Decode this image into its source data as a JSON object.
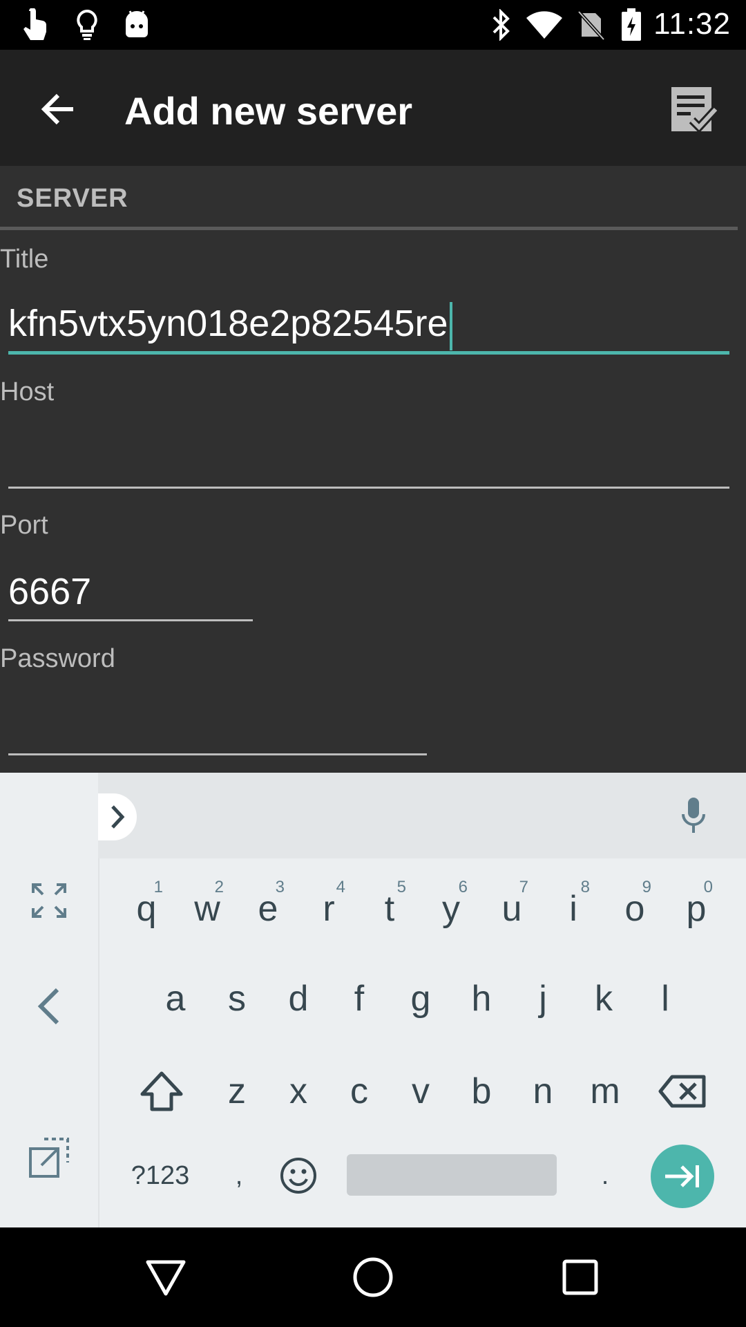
{
  "status_bar": {
    "time": "11:32",
    "left_icons": [
      "touch-hand-icon",
      "lightbulb-icon",
      "android-icon"
    ],
    "right_icons": [
      "bluetooth-icon",
      "wifi-icon",
      "no-sim-icon",
      "battery-charging-icon"
    ]
  },
  "app_bar": {
    "title": "Add new server",
    "back_icon": "arrow-back-icon",
    "save_icon": "checklist-icon"
  },
  "form": {
    "section_header": "SERVER",
    "fields": [
      {
        "label": "Title",
        "value": "kfn5vtx5yn018e2p82545re",
        "placeholder": ""
      },
      {
        "label": "Host",
        "value": "",
        "placeholder": ""
      },
      {
        "label": "Port",
        "value": "6667",
        "placeholder": ""
      },
      {
        "label": "Password",
        "value": "",
        "placeholder": ""
      }
    ]
  },
  "keyboard": {
    "row1": [
      {
        "key": "q",
        "hint": "1"
      },
      {
        "key": "w",
        "hint": "2"
      },
      {
        "key": "e",
        "hint": "3"
      },
      {
        "key": "r",
        "hint": "4"
      },
      {
        "key": "t",
        "hint": "5"
      },
      {
        "key": "y",
        "hint": "6"
      },
      {
        "key": "u",
        "hint": "7"
      },
      {
        "key": "i",
        "hint": "8"
      },
      {
        "key": "o",
        "hint": "9"
      },
      {
        "key": "p",
        "hint": "0"
      }
    ],
    "row2": [
      "a",
      "s",
      "d",
      "f",
      "g",
      "h",
      "j",
      "k",
      "l"
    ],
    "row3": [
      "z",
      "x",
      "c",
      "v",
      "b",
      "n",
      "m"
    ],
    "symbols_label": "?123",
    "comma": ",",
    "period": ".",
    "accent_color": "#4db6ac"
  },
  "nav_bar": {
    "icons": [
      "back-triangle-icon",
      "home-circle-icon",
      "recents-square-icon"
    ]
  }
}
